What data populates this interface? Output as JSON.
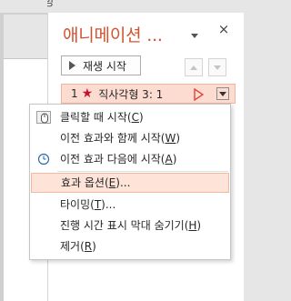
{
  "top_label": "다이빙",
  "pane": {
    "title": "애니메이션 ...",
    "close_glyph": "×",
    "play_label": "재생 시작",
    "item": {
      "number": "1",
      "name": "직사각형 3: 1"
    }
  },
  "menu": {
    "items": [
      {
        "label": "클릭할 때 시작(",
        "key": "C",
        "suffix": ")",
        "icon": "mouse-click-icon"
      },
      {
        "label": "이전 효과와 함께 시작(",
        "key": "W",
        "suffix": ")",
        "icon": ""
      },
      {
        "label": "이전 효과 다음에 시작(",
        "key": "A",
        "suffix": ")",
        "icon": "clock-icon"
      },
      {
        "label": "효과 옵션(",
        "key": "E",
        "suffix": ")..."
      },
      {
        "label": "타이밍(",
        "key": "T",
        "suffix": ")..."
      },
      {
        "label": "진행 시간 표시 막대 숨기기(",
        "key": "H",
        "suffix": ")"
      },
      {
        "label": "제거(",
        "key": "R",
        "suffix": ")"
      }
    ]
  },
  "colors": {
    "accent": "#d35230",
    "selected_bg": "#fcdcd0",
    "star": "#c8102e"
  }
}
